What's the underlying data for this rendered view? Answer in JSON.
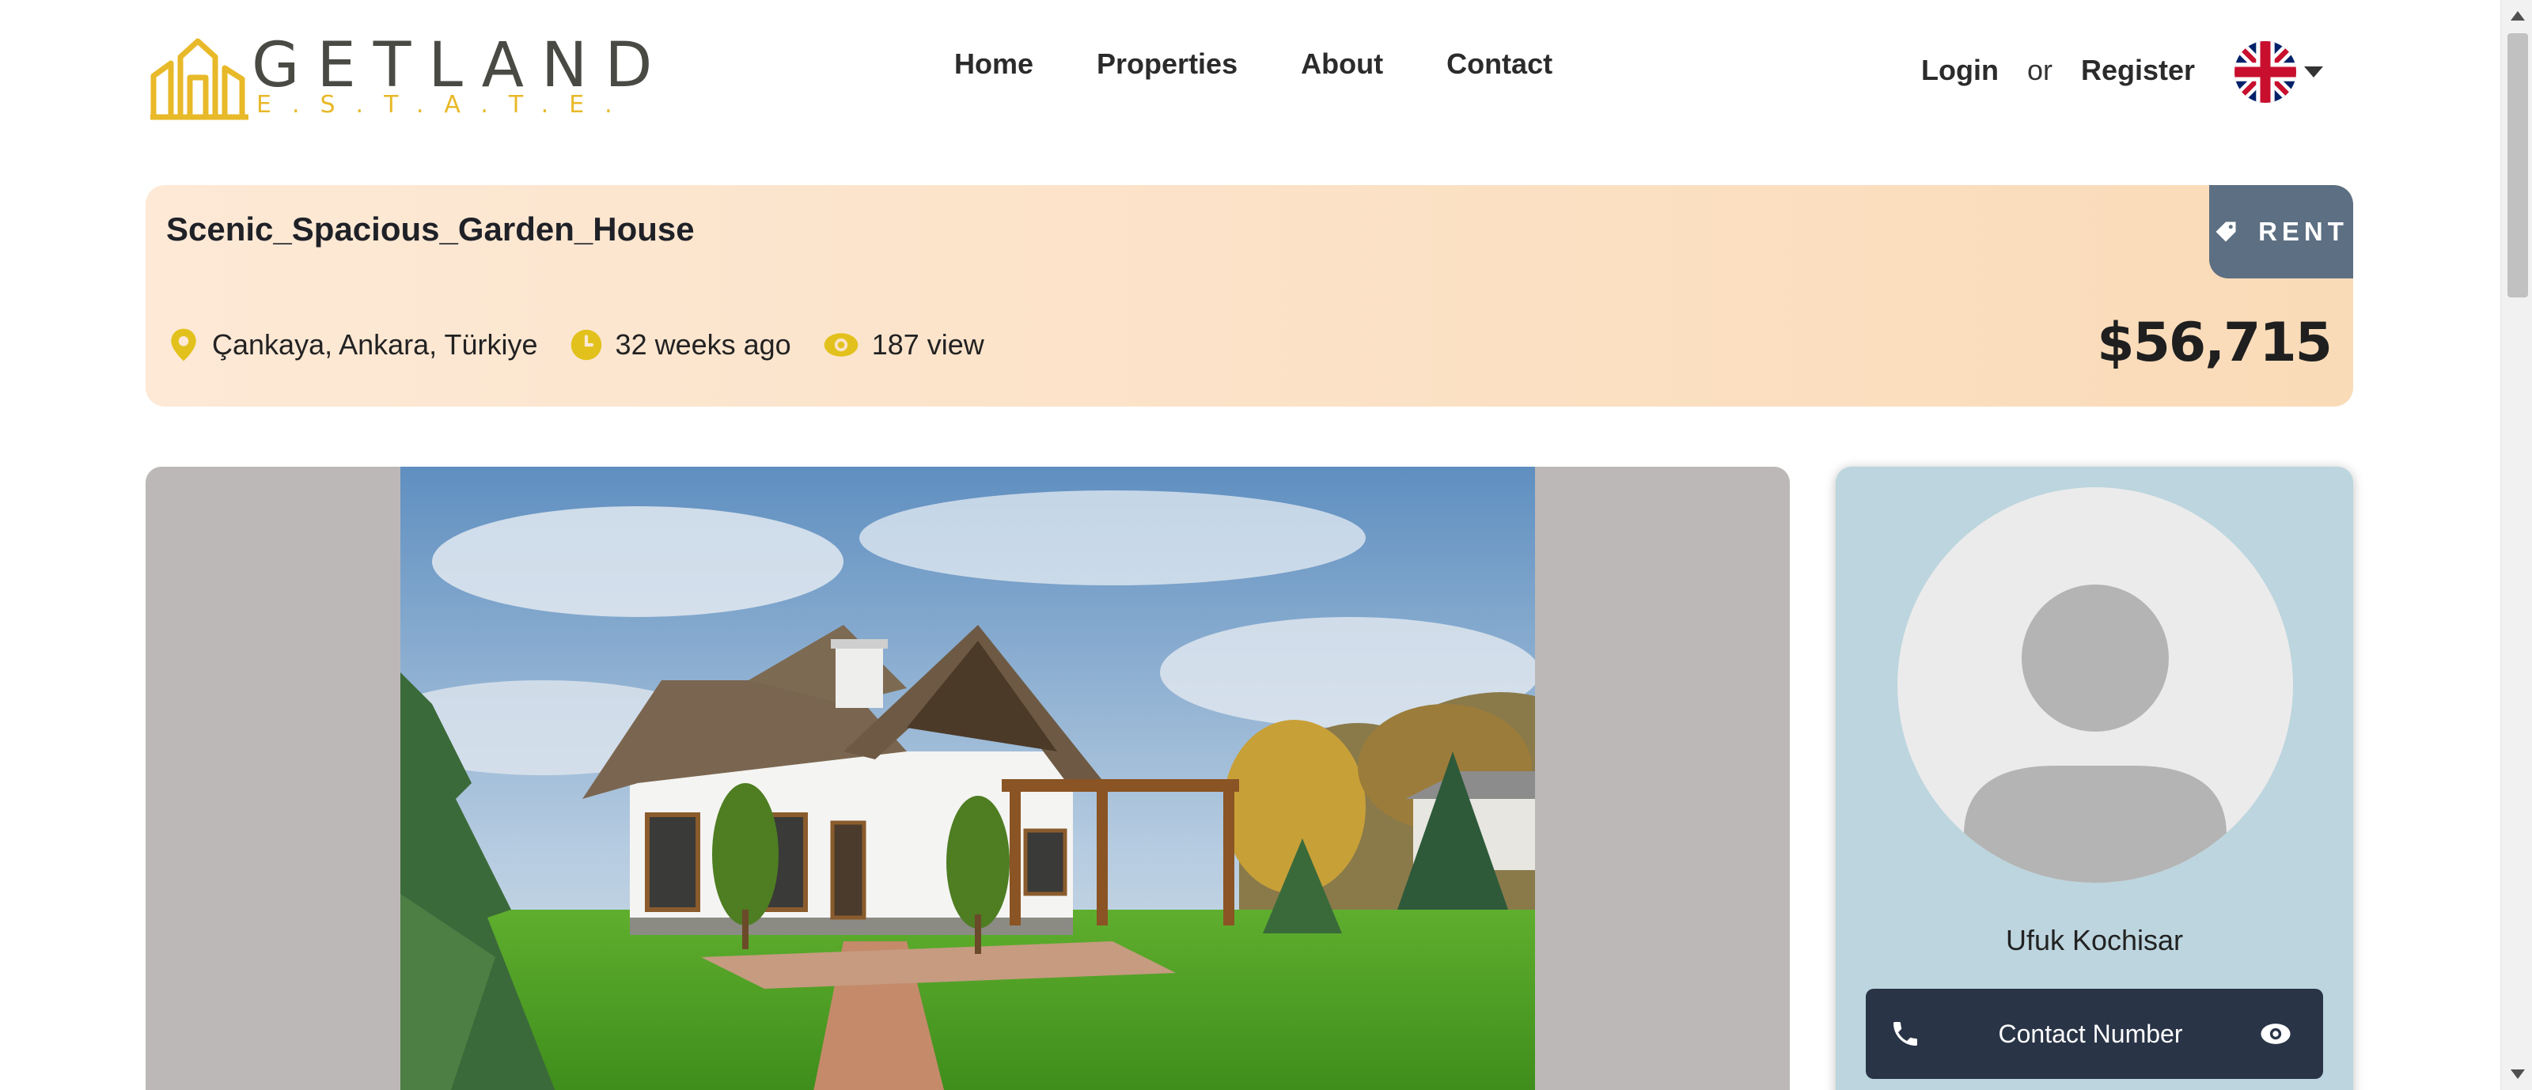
{
  "brand": {
    "name": "GETLAND",
    "tagline": "E.S.T.A.T.E."
  },
  "nav": {
    "items": [
      "Home",
      "Properties",
      "About",
      "Contact"
    ]
  },
  "auth": {
    "login": "Login",
    "or": "or",
    "register": "Register"
  },
  "language": {
    "icon": "uk-flag-icon"
  },
  "listing": {
    "title": "Scenic_Spacious_Garden_House",
    "location": "Çankaya, Ankara, Türkiye",
    "posted": "32 weeks ago",
    "views": "187 view",
    "badge": "RENT",
    "price": "$56,715"
  },
  "agent": {
    "name": "Ufuk Kochisar",
    "contact_label": "Contact Number"
  },
  "colors": {
    "accent_yellow": "#e2c11c",
    "badge_slate": "#5d6f82",
    "button_navy": "#293447",
    "card_blue": "#bcd5de"
  }
}
